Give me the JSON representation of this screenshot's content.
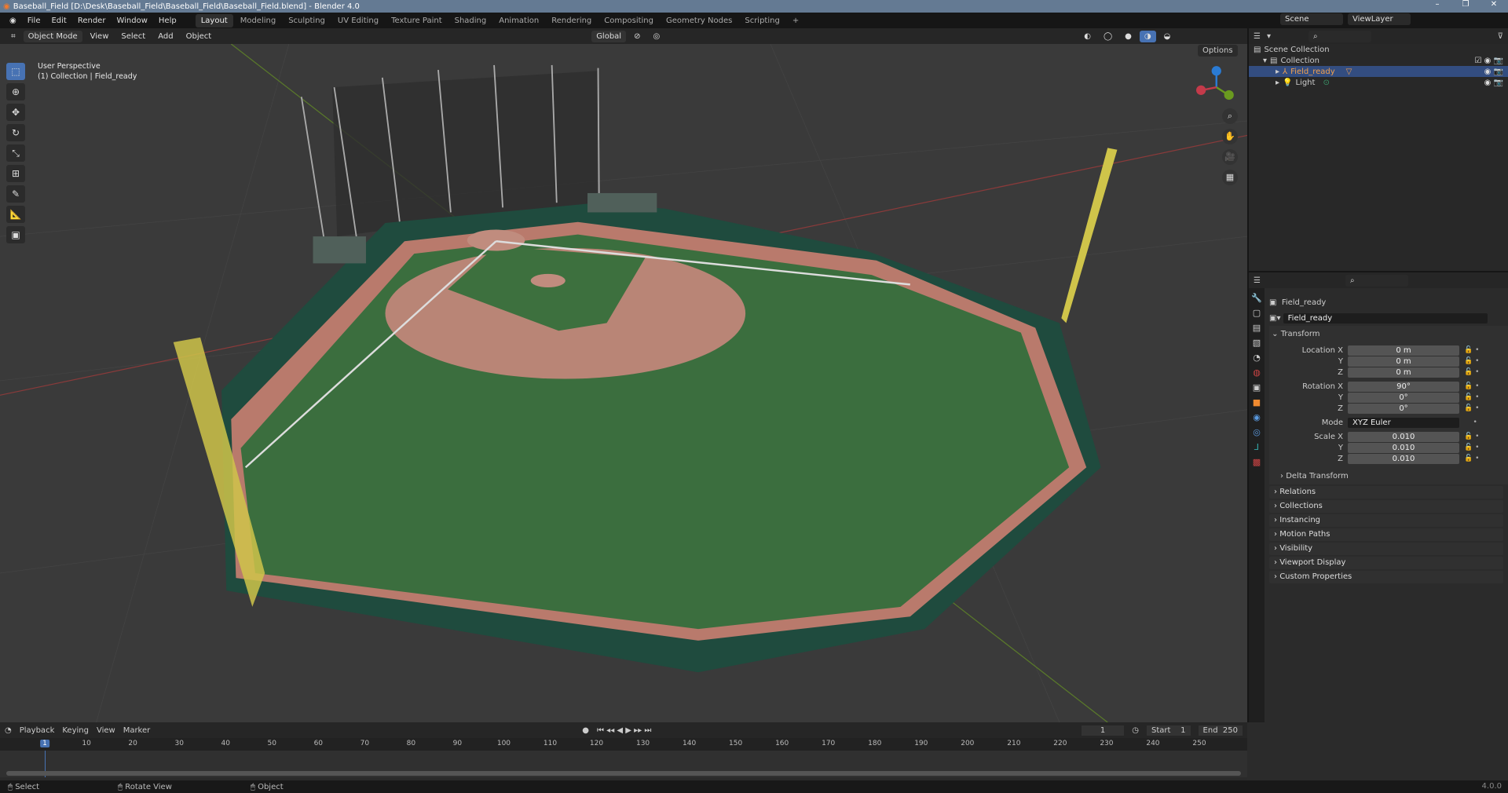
{
  "window": {
    "title": "Baseball_Field [D:\\Desk\\Baseball_Field\\Baseball_Field\\Baseball_Field.blend] - Blender 4.0",
    "controls": [
      "–",
      "❐",
      "✕"
    ]
  },
  "menu": [
    "File",
    "Edit",
    "Render",
    "Window",
    "Help"
  ],
  "workspaces": [
    "Layout",
    "Modeling",
    "Sculpting",
    "UV Editing",
    "Texture Paint",
    "Shading",
    "Animation",
    "Rendering",
    "Compositing",
    "Geometry Nodes",
    "Scripting",
    "+"
  ],
  "scene": "Scene",
  "view_layer": "ViewLayer",
  "viewport_header": {
    "mode": "Object Mode",
    "menus": [
      "View",
      "Select",
      "Add",
      "Object"
    ],
    "orientation": "Global",
    "options": "Options"
  },
  "viewport_info": {
    "line1": "User Perspective",
    "line2": "(1) Collection | Field_ready"
  },
  "gizmo": {
    "z": "Z",
    "y": "Y",
    "x": "X"
  },
  "outliner": {
    "items": [
      {
        "name": "Scene Collection"
      },
      {
        "name": "Collection"
      },
      {
        "name": "Field_ready",
        "selected": true
      },
      {
        "name": "Light"
      }
    ]
  },
  "properties": {
    "object_name": "Field_ready",
    "data_name": "Field_ready",
    "transform_label": "Transform",
    "rows": [
      {
        "label": "Location X",
        "value": "0 m"
      },
      {
        "label": "Y",
        "value": "0 m"
      },
      {
        "label": "Z",
        "value": "0 m"
      },
      {
        "label": "Rotation X",
        "value": "90°"
      },
      {
        "label": "Y",
        "value": "0°"
      },
      {
        "label": "Z",
        "value": "0°"
      },
      {
        "label": "Mode",
        "value": "XYZ Euler"
      },
      {
        "label": "Scale X",
        "value": "0.010"
      },
      {
        "label": "Y",
        "value": "0.010"
      },
      {
        "label": "Z",
        "value": "0.010"
      }
    ],
    "delta": "Delta Transform",
    "panels": [
      "Relations",
      "Collections",
      "Instancing",
      "Motion Paths",
      "Visibility",
      "Viewport Display",
      "Custom Properties"
    ]
  },
  "timeline": {
    "menus": [
      "Playback",
      "Keying",
      "View",
      "Marker"
    ],
    "current_frame": "1",
    "start_label": "Start",
    "start": "1",
    "end_label": "End",
    "end": "250",
    "ticks": [
      "1",
      "10",
      "20",
      "30",
      "40",
      "50",
      "60",
      "70",
      "80",
      "90",
      "100",
      "110",
      "120",
      "130",
      "140",
      "150",
      "160",
      "170",
      "180",
      "190",
      "200",
      "210",
      "220",
      "230",
      "240",
      "250"
    ]
  },
  "status": {
    "items": [
      "Select",
      "Rotate View",
      "Object"
    ],
    "version": "4.0.0"
  }
}
